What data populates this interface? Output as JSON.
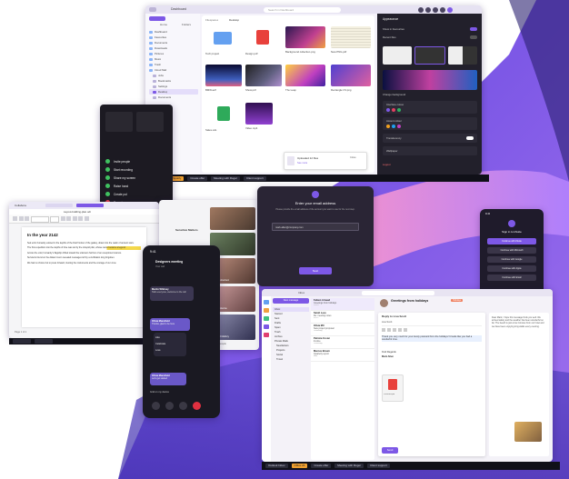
{
  "file_manager": {
    "title": "Dashboard",
    "search_placeholder": "Search in Dashboard",
    "tabs": [
      "Home",
      "Folders"
    ],
    "breadcrumb": [
      "Filespaces",
      "Desktop"
    ],
    "sidebar_items": [
      "Dashboard",
      "Favourites",
      "Documents",
      "Downloads",
      "Pictures",
      "Music",
      "Trash",
      "Cloud Mail",
      "Jobs",
      "Bookmarks",
      "Settings",
      "Desktop",
      "Documents"
    ],
    "files": [
      {
        "name": "Tech project",
        "kind": "folder"
      },
      {
        "name": "Design.pdf",
        "kind": "pdf"
      },
      {
        "name": "Background collection.png",
        "kind": "image"
      },
      {
        "name": "New PNG.pdf",
        "kind": "doc"
      },
      {
        "name": "BMW.avif",
        "kind": "image"
      },
      {
        "name": "Show.pdf",
        "kind": "image"
      },
      {
        "name": "The Leap",
        "kind": "image"
      },
      {
        "name": "Rectangle CV.png",
        "kind": "image"
      },
      {
        "name": "Sales.ods",
        "kind": "sheet"
      },
      {
        "name": "Video.mp4",
        "kind": "video"
      }
    ],
    "upload_toast": {
      "title": "Uploaded 12 files",
      "subtitle": "See more",
      "action": "Close"
    },
    "right_panel": {
      "header": "Appearance",
      "toggles": [
        "Show in Favourites",
        "Recent files"
      ],
      "wallpaper_label": "Change background",
      "cards": [
        "Interface colour",
        "Accent colour",
        "Translucency",
        "Wallpaper"
      ],
      "footer": "Logout"
    }
  },
  "taskbar_top": {
    "items": [
      "Facebook",
      "Spotify",
      "Create offer",
      "Meeting with Roger",
      "Client support"
    ]
  },
  "call_window": {
    "menu_items": [
      "Invite people",
      "Start recording",
      "Share my screen",
      "Raise hand",
      "Create poll",
      "Report"
    ]
  },
  "doc_editor": {
    "app": "Collabora",
    "doc_title": "Layout-building-plan.odt",
    "heading": "In the year 2142",
    "paragraphs": [
      "Sed enim humanity existed in the depths of the final frontier of the galaxy, drawn into the realm of ancient stars.",
      "The first expedition into the depths of time was led by the intrepid pilot, whose name became a legend.",
      "Across the void, humanity's flagship drifted toward the unknown horizon of an unexplored cosmos.",
      "Survivors found on the distant moon revealed messages left by a civilization long forgotten.",
      "We had no choice but to press forward, trusting the instruments and the courage of our crew."
    ],
    "status": "Page 1 of 2"
  },
  "participants": {
    "title": "Sensitive Matters",
    "people": [
      "Alice Robertson",
      "Laura Maxine",
      "Edward Mallory",
      "Laura Lane"
    ],
    "footer": "Hide people"
  },
  "phone_call": {
    "time": "9:41",
    "title": "Designers meeting",
    "subtitle": "Your call",
    "bubbles": [
      {
        "name": "Martin Whitney",
        "text": "Hello everyone, welcome to the call"
      },
      {
        "name": "Olivia Mansfield",
        "text": "Thanks, glad to be here"
      },
      {
        "name": "Olivia Mansfield",
        "text": "Let's get started"
      }
    ],
    "reactions": [
      "Like",
      "Celebrate",
      "Love"
    ],
    "bottom_label": "Grid on my device"
  },
  "email_dialog": {
    "title": "Enter your email address",
    "body": "Please provide the email address of the account you want to use for the next step.",
    "input_value": "mark.allen@company.com",
    "button": "Next"
  },
  "phone_signin": {
    "time": "9:41",
    "title": "Sign in to kSuite",
    "buttons": [
      "Continue with kSuite",
      "Continue with Microsoft",
      "Continue with Google",
      "Continue with Apple",
      "Continue with Email"
    ],
    "qr_text": "Scan to sign in with your phone camera",
    "secondary": "Show QR code to login"
  },
  "mail_client": {
    "title": "Inbox",
    "compose": "New message",
    "folders": [
      "Inbox",
      "Starred",
      "Sent",
      "Drafts",
      "Spam",
      "Trash",
      "Archive",
      "Private Mails",
      "Newsletters",
      "Projects",
      "Social",
      "Travel"
    ],
    "messages": [
      {
        "from": "Fabien Arnaud",
        "subject": "Greetings from holidays",
        "time": "10:24"
      },
      {
        "from": "Sarah Lees",
        "subject": "Re: meeting notes",
        "time": "09:12"
      },
      {
        "from": "Olivia MX",
        "subject": "New project proposal",
        "time": "Yesterday"
      },
      {
        "from": "Patricia Foster",
        "subject": "Invoice",
        "time": "Yesterday"
      },
      {
        "from": "Marcus Brown",
        "subject": "Quarterly report",
        "time": "Mon"
      }
    ],
    "open_subject": "Greetings from holidays",
    "open_badge": "Holidays",
    "reply_title": "Reply to Lisa Scott",
    "reply_to": "Lisa Scott",
    "reply_body": "Thank you very much for your lovely postcard from the holidays! It looks like you had a wonderful time.",
    "signature": "Kind Regards",
    "signer": "Mark Allen",
    "attachment": "Postcard.pdf",
    "send": "Send",
    "right_pane_text": "Dear Mark, I hope this message finds you well. We arrived safely and the weather has been wonderful so far. The beach is just a few minutes from our hotel and we have been enjoying long walks every evening."
  },
  "taskbar_bottom": {
    "items": [
      "Outlook Inbox",
      "Office 24",
      "Create offer",
      "Meeting with Roger",
      "Client support"
    ]
  }
}
